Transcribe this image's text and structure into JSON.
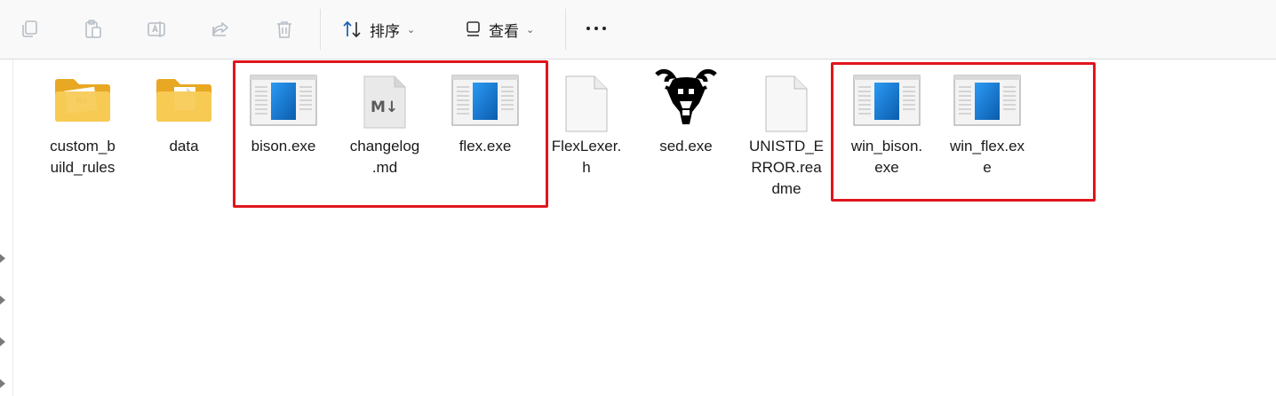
{
  "toolbar": {
    "sort_label": "排序",
    "view_label": "查看",
    "icons": [
      "copy-icon",
      "paste-icon",
      "rename-icon",
      "share-icon",
      "delete-icon"
    ]
  },
  "files": [
    {
      "name": "custom_build_rules",
      "display": "custom_b\nuild_rules",
      "kind": "folder"
    },
    {
      "name": "data",
      "display": "data",
      "kind": "folder"
    },
    {
      "name": "bison.exe",
      "display": "bison.exe",
      "kind": "exe"
    },
    {
      "name": "changelog.md",
      "display": "changelog\n.md",
      "kind": "markdown"
    },
    {
      "name": "flex.exe",
      "display": "flex.exe",
      "kind": "exe"
    },
    {
      "name": "FlexLexer.h",
      "display": "FlexLexer.\nh",
      "kind": "file"
    },
    {
      "name": "sed.exe",
      "display": "sed.exe",
      "kind": "gnu"
    },
    {
      "name": "UNISTD_ERROR.readme",
      "display": "UNISTD_E\nRROR.rea\ndme",
      "kind": "file"
    },
    {
      "name": "win_bison.exe",
      "display": "win_bison.\nexe",
      "kind": "exe"
    },
    {
      "name": "win_flex.exe",
      "display": "win_flex.ex\ne",
      "kind": "exe"
    }
  ],
  "highlight_color": "#e0161d",
  "folder_color": "#f2c14e",
  "exe_accent": "#1476d2"
}
